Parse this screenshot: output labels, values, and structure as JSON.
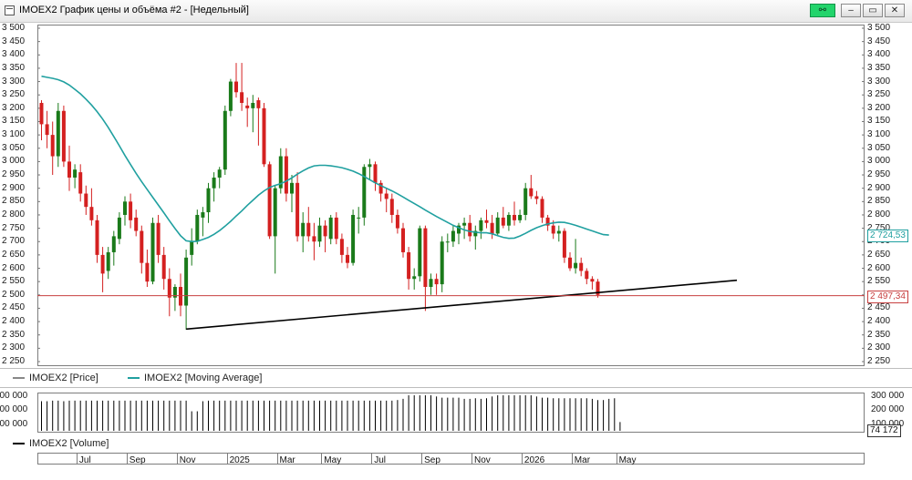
{
  "window": {
    "title": "IMOEX2 График цены и объёма #2 - [Недельный]",
    "buttons": {
      "link": "⚯",
      "minimize": "–",
      "restore": "▭",
      "close": "✕"
    }
  },
  "legend": {
    "price": "IMOEX2 [Price]",
    "ma": "IMOEX2 [Moving Average]",
    "volume": "IMOEX2 [Volume]"
  },
  "labels": {
    "ma_last": "2 724,53",
    "price_last": "2 497,34",
    "volume_last": "74 172"
  },
  "colors": {
    "up": "#1a7a1a",
    "down": "#d42020",
    "ma": "#20a0a0",
    "support_line": "#000000",
    "price_level": "#c84040",
    "volume_bar": "#000000"
  },
  "chart_data": [
    {
      "type": "candlestick",
      "ylim": [
        2250,
        3500
      ],
      "yticks": [
        "3 500",
        "3 450",
        "3 400",
        "3 350",
        "3 300",
        "3 250",
        "3 200",
        "3 150",
        "3 100",
        "3 050",
        "3 000",
        "2 950",
        "2 900",
        "2 850",
        "2 800",
        "2 750",
        "2 700",
        "2 650",
        "2 600",
        "2 550",
        "2 500",
        "2 450",
        "2 400",
        "2 350",
        "2 300",
        "2 250"
      ],
      "x_tick_labels": [
        "Jul",
        "Sep",
        "Nov",
        "2025",
        "Mar",
        "May",
        "Jul",
        "Sep",
        "Nov",
        "2026",
        "Mar",
        "May"
      ],
      "x_tick_weeks": [
        4,
        13,
        22,
        31,
        40,
        48,
        57,
        66,
        75,
        84,
        93,
        101
      ],
      "candles": [
        [
          3220,
          3230,
          3080,
          3140
        ],
        [
          3140,
          3190,
          3050,
          3100
        ],
        [
          3100,
          3150,
          2950,
          3020
        ],
        [
          3020,
          3220,
          2980,
          3190
        ],
        [
          3190,
          3210,
          2980,
          3000
        ],
        [
          3000,
          3060,
          2890,
          2940
        ],
        [
          2940,
          2990,
          2900,
          2970
        ],
        [
          2960,
          2990,
          2850,
          2880
        ],
        [
          2880,
          2910,
          2800,
          2830
        ],
        [
          2830,
          2900,
          2760,
          2780
        ],
        [
          2780,
          2800,
          2620,
          2650
        ],
        [
          2650,
          2680,
          2510,
          2580
        ],
        [
          2590,
          2680,
          2560,
          2660
        ],
        [
          2660,
          2740,
          2610,
          2720
        ],
        [
          2710,
          2810,
          2690,
          2790
        ],
        [
          2800,
          2870,
          2760,
          2850
        ],
        [
          2850,
          2880,
          2750,
          2780
        ],
        [
          2790,
          2820,
          2720,
          2740
        ],
        [
          2740,
          2760,
          2580,
          2620
        ],
        [
          2620,
          2670,
          2530,
          2550
        ],
        [
          2550,
          2790,
          2540,
          2770
        ],
        [
          2770,
          2800,
          2620,
          2650
        ],
        [
          2650,
          2680,
          2520,
          2560
        ],
        [
          2560,
          2600,
          2420,
          2490
        ],
        [
          2490,
          2540,
          2440,
          2530
        ],
        [
          2530,
          2580,
          2420,
          2460
        ],
        [
          2460,
          2670,
          2370,
          2640
        ],
        [
          2650,
          2750,
          2610,
          2700
        ],
        [
          2700,
          2820,
          2690,
          2800
        ],
        [
          2790,
          2830,
          2720,
          2810
        ],
        [
          2810,
          2920,
          2770,
          2900
        ],
        [
          2900,
          2960,
          2850,
          2940
        ],
        [
          2940,
          2980,
          2900,
          2970
        ],
        [
          2970,
          3210,
          2950,
          3190
        ],
        [
          3190,
          3310,
          3170,
          3300
        ],
        [
          3300,
          3370,
          3240,
          3260
        ],
        [
          3260,
          3370,
          3190,
          3220
        ],
        [
          3210,
          3240,
          3130,
          3200
        ],
        [
          3200,
          3250,
          3110,
          3220
        ],
        [
          3230,
          3240,
          3060,
          3200
        ],
        [
          3200,
          3220,
          2980,
          2990
        ],
        [
          2990,
          3000,
          2710,
          2720
        ],
        [
          2720,
          2910,
          2580,
          2900
        ],
        [
          2900,
          3050,
          2880,
          3020
        ],
        [
          3020,
          3050,
          2850,
          2880
        ],
        [
          2880,
          2950,
          2810,
          2920
        ],
        [
          2920,
          2960,
          2700,
          2720
        ],
        [
          2720,
          2810,
          2660,
          2770
        ],
        [
          2770,
          2830,
          2700,
          2720
        ],
        [
          2720,
          2770,
          2630,
          2700
        ],
        [
          2700,
          2790,
          2680,
          2760
        ],
        [
          2760,
          2780,
          2660,
          2720
        ],
        [
          2710,
          2800,
          2690,
          2790
        ],
        [
          2790,
          2810,
          2690,
          2710
        ],
        [
          2710,
          2730,
          2620,
          2650
        ],
        [
          2650,
          2680,
          2600,
          2620
        ],
        [
          2620,
          2820,
          2610,
          2800
        ],
        [
          2790,
          2830,
          2730,
          2790
        ],
        [
          2790,
          2990,
          2760,
          2980
        ],
        [
          2980,
          3010,
          2930,
          2990
        ],
        [
          2990,
          3000,
          2890,
          2920
        ],
        [
          2920,
          2930,
          2850,
          2880
        ],
        [
          2880,
          2900,
          2810,
          2860
        ],
        [
          2860,
          2880,
          2770,
          2800
        ],
        [
          2800,
          2820,
          2730,
          2750
        ],
        [
          2750,
          2770,
          2640,
          2660
        ],
        [
          2660,
          2680,
          2520,
          2560
        ],
        [
          2560,
          2600,
          2520,
          2570
        ],
        [
          2570,
          2760,
          2550,
          2750
        ],
        [
          2750,
          2760,
          2440,
          2530
        ],
        [
          2530,
          2580,
          2500,
          2560
        ],
        [
          2560,
          2580,
          2500,
          2540
        ],
        [
          2540,
          2720,
          2510,
          2700
        ],
        [
          2700,
          2730,
          2660,
          2700
        ],
        [
          2700,
          2760,
          2680,
          2740
        ],
        [
          2730,
          2770,
          2690,
          2760
        ],
        [
          2760,
          2790,
          2710,
          2770
        ],
        [
          2770,
          2800,
          2700,
          2720
        ],
        [
          2720,
          2760,
          2670,
          2740
        ],
        [
          2740,
          2790,
          2710,
          2780
        ],
        [
          2780,
          2820,
          2750,
          2770
        ],
        [
          2770,
          2800,
          2710,
          2730
        ],
        [
          2730,
          2810,
          2720,
          2790
        ],
        [
          2790,
          2830,
          2750,
          2760
        ],
        [
          2760,
          2810,
          2740,
          2800
        ],
        [
          2800,
          2850,
          2760,
          2780
        ],
        [
          2780,
          2820,
          2770,
          2800
        ],
        [
          2800,
          2920,
          2780,
          2900
        ],
        [
          2900,
          2950,
          2860,
          2870
        ],
        [
          2870,
          2890,
          2840,
          2860
        ],
        [
          2860,
          2870,
          2770,
          2790
        ],
        [
          2790,
          2800,
          2740,
          2760
        ],
        [
          2760,
          2780,
          2710,
          2730
        ],
        [
          2730,
          2760,
          2700,
          2740
        ],
        [
          2740,
          2750,
          2620,
          2640
        ],
        [
          2640,
          2660,
          2590,
          2600
        ],
        [
          2600,
          2710,
          2580,
          2620
        ],
        [
          2620,
          2640,
          2570,
          2590
        ],
        [
          2590,
          2600,
          2540,
          2560
        ],
        [
          2560,
          2570,
          2520,
          2550
        ],
        [
          2550,
          2560,
          2490,
          2500
        ]
      ],
      "moving_average": [
        3320,
        3316,
        3312,
        3307,
        3299,
        3287,
        3271,
        3254,
        3234,
        3212,
        3187,
        3159,
        3128,
        3094,
        3059,
        3023,
        2989,
        2956,
        2925,
        2895,
        2866,
        2837,
        2808,
        2778,
        2749,
        2722,
        2703,
        2700,
        2701,
        2708,
        2716,
        2727,
        2741,
        2758,
        2776,
        2796,
        2815,
        2836,
        2855,
        2874,
        2890,
        2903,
        2911,
        2917,
        2927,
        2939,
        2953,
        2965,
        2976,
        2984,
        2986,
        2986,
        2984,
        2981,
        2977,
        2971,
        2964,
        2955,
        2944,
        2932,
        2920,
        2910,
        2900,
        2890,
        2879,
        2867,
        2855,
        2843,
        2831,
        2818,
        2806,
        2794,
        2783,
        2772,
        2761,
        2752,
        2744,
        2738,
        2735,
        2733,
        2733,
        2729,
        2722,
        2716,
        2712,
        2713,
        2721,
        2731,
        2742,
        2752,
        2760,
        2766,
        2770,
        2773,
        2772,
        2767,
        2761,
        2754,
        2747,
        2740,
        2733,
        2726,
        2724.53
      ],
      "support_line": {
        "from": [
          26,
          2372
        ],
        "to": [
          125,
          2555
        ]
      },
      "price_level": 2497.34,
      "last_price": 2497.34,
      "last_ma": 2724.53,
      "series": [
        {
          "name": "IMOEX2 [Price]"
        },
        {
          "name": "IMOEX2 [Moving Average]"
        }
      ]
    },
    {
      "type": "bar",
      "ylim": [
        0,
        300000
      ],
      "yticks": [
        "300 000",
        "200 000",
        "100 000"
      ],
      "left_ticks": [
        "300 000",
        "200 000",
        "100 000"
      ],
      "volumes": [
        250000,
        250000,
        255000,
        255000,
        250000,
        255000,
        255000,
        255000,
        255000,
        255000,
        255000,
        255000,
        255000,
        255000,
        255000,
        255000,
        255000,
        255000,
        255000,
        255000,
        255000,
        255000,
        255000,
        255000,
        255000,
        255000,
        255000,
        165000,
        165000,
        250000,
        255000,
        255000,
        255000,
        255000,
        255000,
        255000,
        255000,
        255000,
        255000,
        255000,
        255000,
        255000,
        255000,
        255000,
        255000,
        255000,
        255000,
        255000,
        255000,
        255000,
        255000,
        255000,
        255000,
        255000,
        255000,
        255000,
        255000,
        255000,
        255000,
        255000,
        255000,
        255000,
        255000,
        255000,
        260000,
        270000,
        300000,
        300000,
        300000,
        300000,
        300000,
        290000,
        280000,
        280000,
        280000,
        280000,
        270000,
        270000,
        275000,
        270000,
        275000,
        290000,
        300000,
        300000,
        300000,
        300000,
        300000,
        300000,
        300000,
        290000,
        280000,
        280000,
        275000,
        275000,
        275000,
        275000,
        275000,
        275000,
        275000,
        270000,
        260000,
        260000,
        270000,
        275000,
        74172
      ],
      "last_value": 74172,
      "series": [
        {
          "name": "IMOEX2 [Volume]"
        }
      ]
    }
  ]
}
